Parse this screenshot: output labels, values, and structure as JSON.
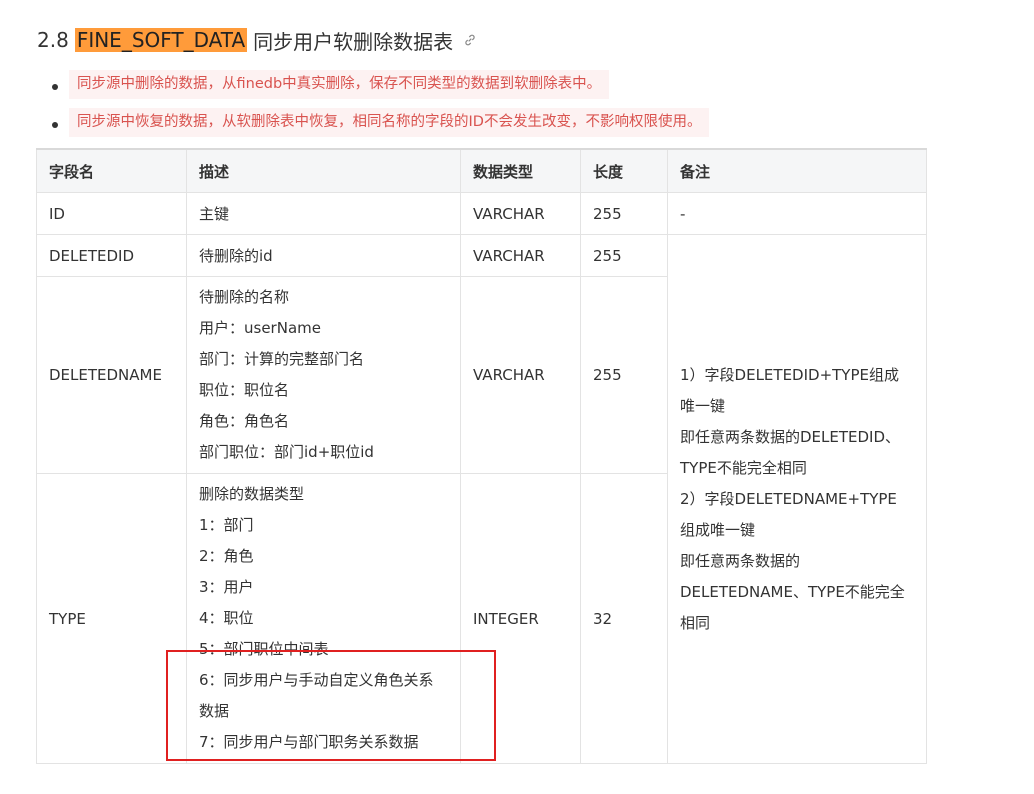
{
  "heading": {
    "number": "2.8",
    "highlight": "FINE_SOFT_DATA",
    "title": "同步用户软删除数据表"
  },
  "notes": [
    "同步源中删除的数据，从finedb中真实删除，保存不同类型的数据到软删除表中。",
    "同步源中恢复的数据，从软删除表中恢复，相同名称的字段的ID不会发生改变，不影响权限使用。"
  ],
  "table": {
    "headers": [
      "字段名",
      "描述",
      "数据类型",
      "长度",
      "备注"
    ],
    "rows": {
      "id": {
        "field": "ID",
        "desc": "主键",
        "type": "VARCHAR",
        "length": "255",
        "remark": "-"
      },
      "deletedid": {
        "field": "DELETEDID",
        "desc": "待删除的id",
        "type": "VARCHAR",
        "length": "255"
      },
      "deletedname": {
        "field": "DELETEDNAME",
        "desc": [
          "待删除的名称",
          "用户：userName",
          "部门：计算的完整部门名",
          "职位：职位名",
          "角色：角色名",
          "部门职位：部门id+职位id"
        ],
        "type": "VARCHAR",
        "length": "255"
      },
      "type": {
        "field": "TYPE",
        "desc": [
          "删除的数据类型",
          "1：部门",
          "2：角色",
          "3：用户",
          "4：职位",
          "5：部门职位中间表",
          "6：同步用户与手动自定义角色关系",
          "数据",
          "7：同步用户与部门职务关系数据"
        ],
        "type": "INTEGER",
        "length": "32"
      }
    },
    "merged_remark": [
      "1）字段DELETEDID+TYPE组成",
      "唯一键",
      "即任意两条数据的DELETEDID、",
      "TYPE不能完全相同",
      "2）字段DELETEDNAME+TYPE",
      "组成唯一键",
      "即任意两条数据的",
      "DELETEDNAME、TYPE不能完全",
      "相同"
    ]
  },
  "annotation_color": "#e02020",
  "highlight_color": "#ff9b3a"
}
